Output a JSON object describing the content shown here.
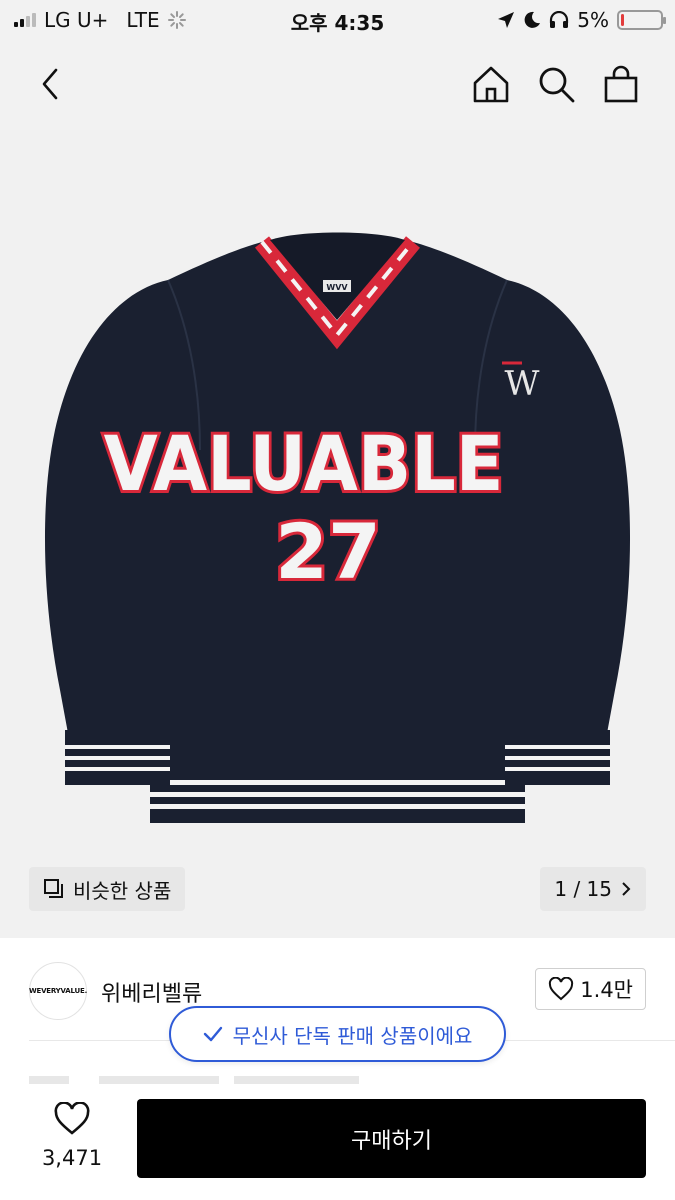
{
  "status_bar": {
    "carrier": "LG U+",
    "network": "LTE",
    "time": "오후 4:35",
    "battery": "5%",
    "battery_level": 0.05
  },
  "nav": {
    "back_icon": "chevron-left-icon",
    "home_icon": "home-icon",
    "search_icon": "search-icon",
    "cart_icon": "shopping-bag-icon"
  },
  "product_image": {
    "chest_text": "VALUABLE",
    "number_text": "27",
    "neck_label": "WVV",
    "colors": {
      "body": "#1a2030",
      "red": "#d8283a",
      "white": "#f4f4f4"
    }
  },
  "image_controls": {
    "similar_label": "비슷한 상품",
    "pager": "1 / 15"
  },
  "brand": {
    "logo_text": "WEVERYVALUE.",
    "name": "위베리벨류",
    "likes": "1.4만"
  },
  "exclusive_badge": "무신사 단독 판매 상품이에요",
  "bottom_bar": {
    "wish_count": "3,471",
    "buy_label": "구매하기"
  }
}
